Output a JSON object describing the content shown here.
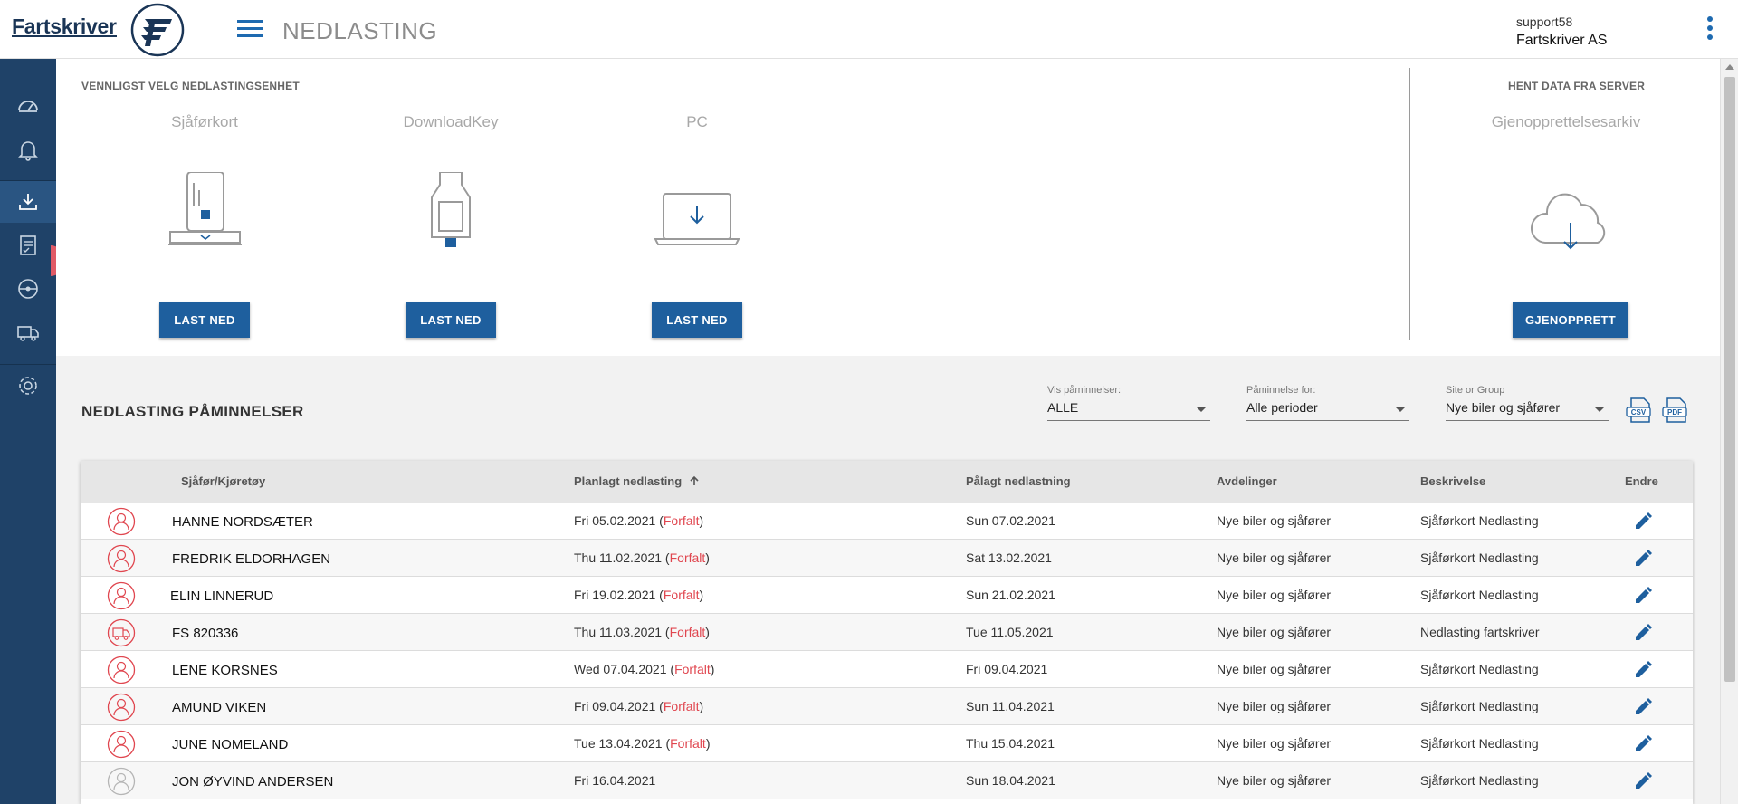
{
  "app": {
    "brand": "Fartskriver",
    "page_title": "NEDLASTING"
  },
  "user": {
    "username": "support58",
    "company": "Fartskriver AS"
  },
  "sidebar": {
    "items": [
      {
        "icon": "speedometer-icon"
      },
      {
        "icon": "bell-icon"
      },
      {
        "icon": "download-icon",
        "active": true
      },
      {
        "icon": "report-icon"
      },
      {
        "icon": "steering-wheel-icon"
      },
      {
        "icon": "truck-icon"
      },
      {
        "icon": "gear-icon"
      }
    ]
  },
  "download": {
    "heading": "VENNLIGST VELG NEDLASTINGSENHET",
    "devices": [
      {
        "title": "Sjåførkort",
        "button": "LAST NED",
        "icon": "driver-card-reader-icon"
      },
      {
        "title": "DownloadKey",
        "button": "LAST NED",
        "icon": "download-key-icon"
      },
      {
        "title": "PC",
        "button": "LAST NED",
        "icon": "laptop-download-icon"
      }
    ],
    "server_heading": "HENT DATA FRA SERVER",
    "server": {
      "title": "Gjenopprettelsesarkiv",
      "button": "GJENOPPRETT",
      "icon": "cloud-download-icon"
    }
  },
  "reminders": {
    "title": "NEDLASTING PÅMINNELSER",
    "filters": [
      {
        "label": "Vis påminnelser:",
        "value": "ALLE"
      },
      {
        "label": "Påminnelse for:",
        "value": "Alle perioder"
      },
      {
        "label": "Site or Group",
        "value": "Nye biler og sjåfører"
      }
    ],
    "exports": [
      {
        "label": "CSV"
      },
      {
        "label": "PDF"
      }
    ],
    "columns": {
      "name": "Sjåfør/Kjøretøy",
      "planned": "Planlagt nedlasting",
      "required": "Pålagt nedlastning",
      "departments": "Avdelinger",
      "description": "Beskrivelse",
      "edit": "Endre"
    },
    "rows": [
      {
        "type": "driver",
        "name": "HANNE NORDSÆTER",
        "planned": "Fri 05.02.2021",
        "status": "Forfalt",
        "required": "Sun 07.02.2021",
        "department": "Nye biler og sjåfører",
        "description": "Sjåførkort Nedlasting"
      },
      {
        "type": "driver",
        "name": "FREDRIK ELDORHAGEN",
        "planned": "Thu 11.02.2021",
        "status": "Forfalt",
        "required": "Sat 13.02.2021",
        "department": "Nye biler og sjåfører",
        "description": "Sjåførkort Nedlasting"
      },
      {
        "type": "driver",
        "name": "ELIN LINNERUD",
        "planned": "Fri 19.02.2021",
        "status": "Forfalt",
        "required": "Sun 21.02.2021",
        "department": "Nye biler og sjåfører",
        "description": "Sjåførkort Nedlasting"
      },
      {
        "type": "vehicle",
        "name": "FS 820336",
        "planned": "Thu 11.03.2021",
        "status": "Forfalt",
        "required": "Tue 11.05.2021",
        "department": "Nye biler og sjåfører",
        "description": "Nedlasting fartskriver"
      },
      {
        "type": "driver",
        "name": "LENE KORSNES",
        "planned": "Wed 07.04.2021",
        "status": "Forfalt",
        "required": "Fri 09.04.2021",
        "department": "Nye biler og sjåfører",
        "description": "Sjåførkort Nedlasting"
      },
      {
        "type": "driver",
        "name": "AMUND VIKEN",
        "planned": "Fri 09.04.2021",
        "status": "Forfalt",
        "required": "Sun 11.04.2021",
        "department": "Nye biler og sjåfører",
        "description": "Sjåførkort Nedlasting"
      },
      {
        "type": "driver",
        "name": "JUNE NOMELAND",
        "planned": "Tue 13.04.2021",
        "status": "Forfalt",
        "required": "Thu 15.04.2021",
        "department": "Nye biler og sjåfører",
        "description": "Sjåførkort Nedlasting"
      },
      {
        "type": "driver-ok",
        "name": "JON ØYVIND ANDERSEN",
        "planned": "Fri 16.04.2021",
        "status": "",
        "required": "Sun 18.04.2021",
        "department": "Nye biler og sjåfører",
        "description": "Sjåførkort Nedlasting"
      }
    ]
  },
  "colors": {
    "brand": "#1f4268",
    "accent": "#1e5f9e",
    "overdue": "#e0464f"
  }
}
